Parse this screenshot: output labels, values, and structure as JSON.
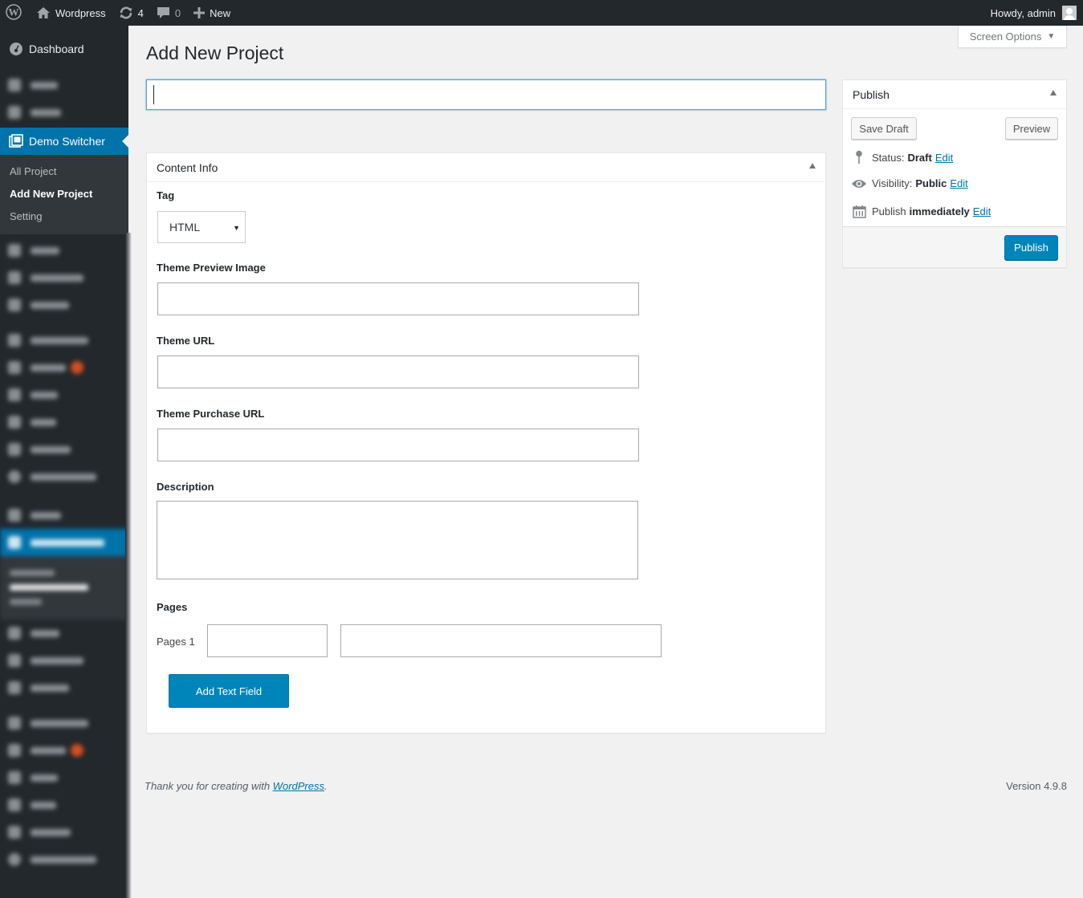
{
  "adminbar": {
    "logo_icon": "wordpress-logo-icon",
    "site_name": "Wordpress",
    "site_icon": "home-icon",
    "updates_icon": "updates-icon",
    "updates_count": "4",
    "comments_icon": "comment-bubble-icon",
    "comments_count": "0",
    "new_icon": "plus-icon",
    "new_label": "New",
    "greeting": "Howdy, admin",
    "avatar_icon": "avatar-placeholder-icon"
  },
  "sidebar": {
    "dashboard_label": "Dashboard",
    "current_menu": {
      "label": "Demo Switcher",
      "icon": "demo-switcher-icon",
      "submenu": [
        {
          "label": "All Project",
          "current": false
        },
        {
          "label": "Add New Project",
          "current": true
        },
        {
          "label": "Setting",
          "current": false
        }
      ]
    },
    "note": "Remaining menu items are blurred in the screenshot"
  },
  "screen_options": {
    "label": "Screen Options",
    "arrow": "▼"
  },
  "page": {
    "title": "Add New Project",
    "title_input_value": ""
  },
  "content_info": {
    "heading": "Content Info",
    "tag": {
      "label": "Tag",
      "selected": "HTML"
    },
    "theme_preview_image": {
      "label": "Theme Preview Image",
      "value": ""
    },
    "theme_url": {
      "label": "Theme URL",
      "value": ""
    },
    "theme_purchase_url": {
      "label": "Theme Purchase URL",
      "value": ""
    },
    "description": {
      "label": "Description",
      "value": ""
    },
    "pages": {
      "label": "Pages",
      "rows": [
        {
          "label": "Pages 1",
          "name_value": "",
          "url_value": ""
        }
      ]
    },
    "add_text_field_label": "Add Text Field"
  },
  "publish": {
    "heading": "Publish",
    "save_draft_label": "Save Draft",
    "preview_label": "Preview",
    "status_prefix": "Status:",
    "status_value": "Draft",
    "visibility_prefix": "Visibility:",
    "visibility_value": "Public",
    "schedule_prefix": "Publish",
    "schedule_value": "immediately",
    "edit_label": "Edit",
    "publish_label": "Publish"
  },
  "footer": {
    "thanks_prefix": "Thank you for creating with ",
    "thanks_link": "WordPress",
    "thanks_suffix": ".",
    "version": "Version 4.9.8"
  },
  "colors": {
    "adminbar_bg": "#23282d",
    "accent": "#0073aa",
    "button_primary": "#0085ba",
    "page_bg": "#f1f1f1",
    "plugin_badge": "#d54e21"
  }
}
